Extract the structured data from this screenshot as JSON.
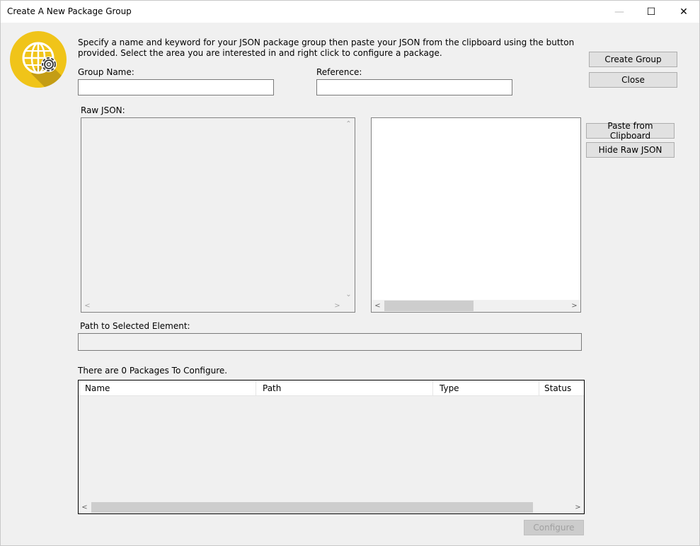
{
  "window": {
    "title": "Create A New Package Group",
    "minimize_glyph": "—",
    "maximize_glyph": "☐",
    "close_glyph": "✕"
  },
  "logo": {
    "icon": "globe-gear-icon",
    "colors": {
      "circle": "#f0c419",
      "shadow": "#a07d12",
      "globe": "#ffffff"
    }
  },
  "instructions": "Specify a name and keyword for your JSON package group then paste your JSON from the clipboard using the button provided. Select the area you are interested in and right click to configure a package.",
  "group_name": {
    "label": "Group Name:",
    "value": ""
  },
  "reference": {
    "label": "Reference:",
    "value": ""
  },
  "buttons": {
    "create_group": "Create Group",
    "close": "Close",
    "paste_from_clipboard": "Paste from Clipboard",
    "hide_raw_json": "Hide Raw JSON",
    "configure": "Configure"
  },
  "raw_json": {
    "label": "Raw JSON:",
    "value": ""
  },
  "path": {
    "label": "Path to Selected Element:",
    "value": ""
  },
  "packages": {
    "count_text": "There are 0 Packages To Configure.",
    "columns": [
      "Name",
      "Path",
      "Type",
      "Status"
    ],
    "rows": []
  },
  "scroll_glyphs": {
    "up": "⌃",
    "down": "⌄",
    "left": "<",
    "right": ">"
  }
}
